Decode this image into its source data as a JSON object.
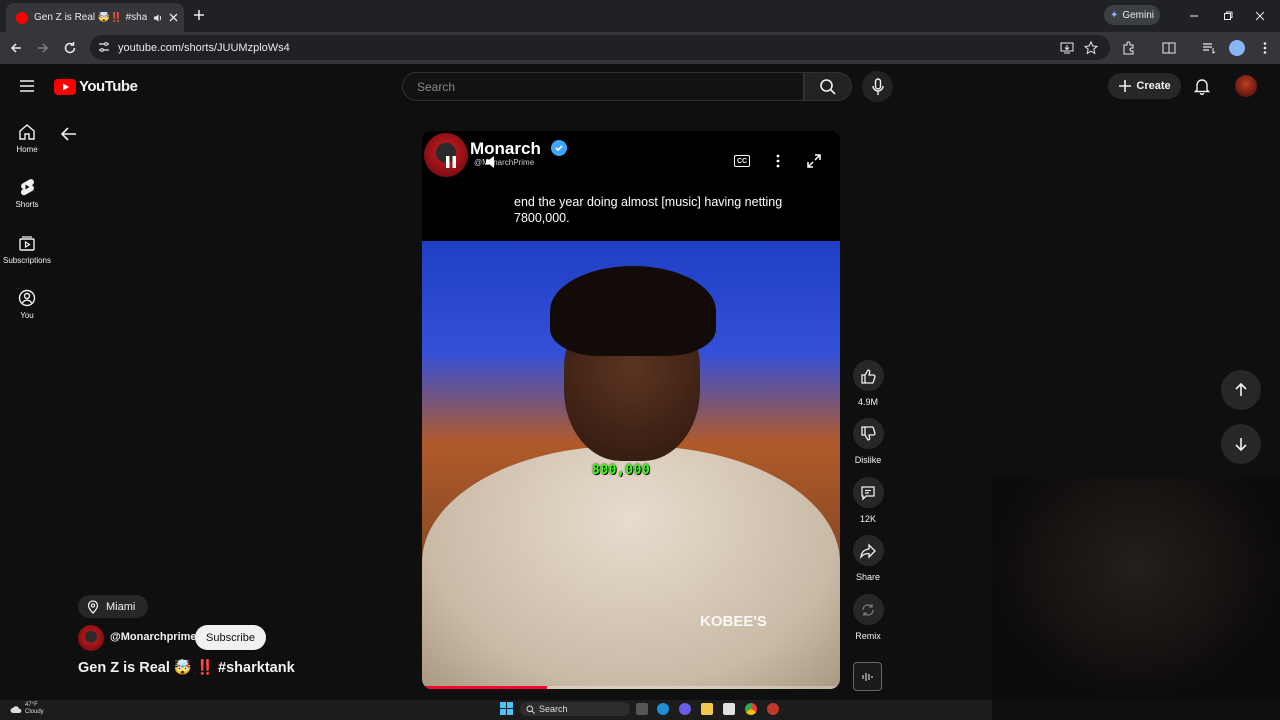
{
  "browser": {
    "tab_title": "Gen Z is Real 🤯‼️ #sharktank",
    "url": "youtube.com/shorts/JUUMzploWs4",
    "gemini_label": "Gemini"
  },
  "header": {
    "logo_text": "YouTube",
    "search_placeholder": "Search",
    "create_label": "Create"
  },
  "sidebar": {
    "items": [
      {
        "label": "Home",
        "icon": "home-icon"
      },
      {
        "label": "Shorts",
        "icon": "shorts-icon"
      },
      {
        "label": "Subscriptions",
        "icon": "subscriptions-icon"
      },
      {
        "label": "You",
        "icon": "you-icon"
      }
    ]
  },
  "video": {
    "channel_name": "Monarch",
    "channel_handle": "@MonarchPrime",
    "cc_label": "CC",
    "caption": "end the year doing almost [music] having netting 7800,000.",
    "overlay_number": "800,000",
    "shirt_text": "KOBEE'S",
    "progress": 0.3
  },
  "actions": {
    "likes": "4.9M",
    "dislike_label": "Dislike",
    "comments": "12K",
    "share_label": "Share",
    "remix_label": "Remix"
  },
  "meta": {
    "location": "Miami",
    "handle": "@Monarchprime",
    "subscribe_label": "Subscribe",
    "title": "Gen Z is Real 🤯 ‼️ #sharktank"
  },
  "taskbar": {
    "temperature": "47°F",
    "condition": "Cloudy",
    "search_label": "Search"
  },
  "colors": {
    "brand_red": "#ff0000",
    "progress_red": "#ff0033",
    "overlay_green": "#39ff14",
    "verified_blue": "#3ea6ff"
  }
}
